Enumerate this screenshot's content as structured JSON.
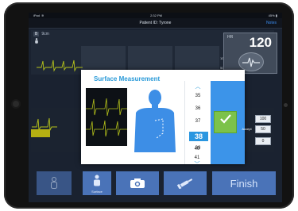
{
  "status_bar": {
    "carrier": "iPad",
    "time": "2:32 PM",
    "battery": "45%"
  },
  "nav": {
    "title": "Patient ID: Tyrone",
    "notes": "Notes"
  },
  "monitor": {
    "bed_badge": "B",
    "bed_label": "9cm",
    "hr_label": "HR",
    "hr_value": "120",
    "scale_top": "100",
    "scale_bottom": "50",
    "value_boxes": [
      "100",
      "50",
      "0"
    ]
  },
  "dialog": {
    "title": "Surface Measurement",
    "picker_values": [
      "35",
      "36",
      "37",
      "38",
      "39",
      "40",
      "41"
    ],
    "selected_value": "38",
    "accept_label": "Accept"
  },
  "toolbar": {
    "surface_label": "Surface",
    "finish_label": "Finish",
    "icons": [
      "person-icon",
      "camera-icon",
      "syringe-icon"
    ]
  },
  "colors": {
    "accent": "#2a9ad8",
    "button": "#4a73b8",
    "accept": "#7cc24a",
    "waveform": "#b5c21a"
  }
}
